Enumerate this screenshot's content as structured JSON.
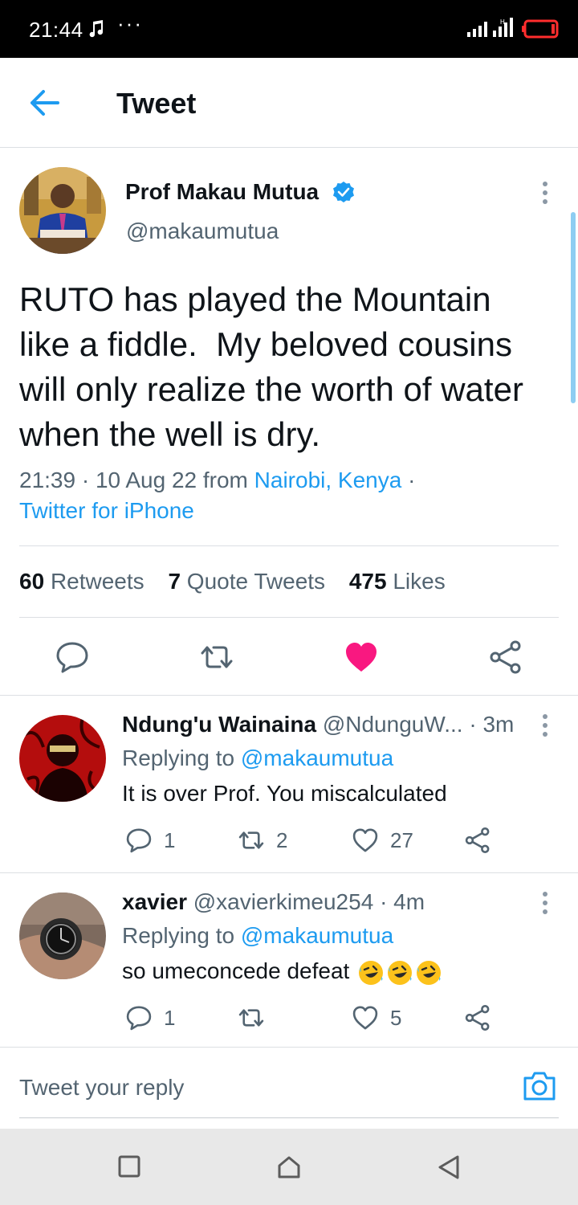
{
  "status_bar": {
    "time": "21:44",
    "dots": "···",
    "music_icon": "music-note-icon",
    "battery_color": "#ff2d2d"
  },
  "header": {
    "title": "Tweet",
    "back_icon": "arrow-left-icon",
    "accent": "#1d9bf0"
  },
  "tweet": {
    "author_name": "Prof Makau Mutua",
    "author_handle": "@makaumutua",
    "verified": true,
    "text": "RUTO has played the Mountain\nlike a fiddle.  My beloved cousins\nwill only realize the worth of water\nwhen the well is dry.",
    "time": "21:39",
    "date": "10 Aug 22",
    "from_label": "from",
    "location": "Nairobi, Kenya",
    "source": "Twitter for iPhone",
    "stats": {
      "retweets_count": "60",
      "retweets_label": "Retweets",
      "quotes_count": "7",
      "quotes_label": "Quote Tweets",
      "likes_count": "475",
      "likes_label": "Likes"
    },
    "liked": true,
    "like_color": "#f91880"
  },
  "replies": [
    {
      "name": "Ndung'u Wainaina",
      "handle": "@NdunguW...",
      "time": "3m",
      "replying_label": "Replying to",
      "replying_to": "@makaumutua",
      "text": "It is over Prof. You miscalculated",
      "reply_count": "1",
      "retweet_count": "2",
      "like_count": "27"
    },
    {
      "name": "xavier",
      "handle": "@xavierkimeu254",
      "time": "4m",
      "replying_label": "Replying to",
      "replying_to": "@makaumutua",
      "text": "so umeconcede defeat",
      "emoji": "rolling-on-floor-laughing-emoji",
      "reply_count": "1",
      "retweet_count": "",
      "like_count": "5"
    }
  ],
  "compose": {
    "placeholder": "Tweet your reply",
    "camera_icon": "camera-icon"
  }
}
